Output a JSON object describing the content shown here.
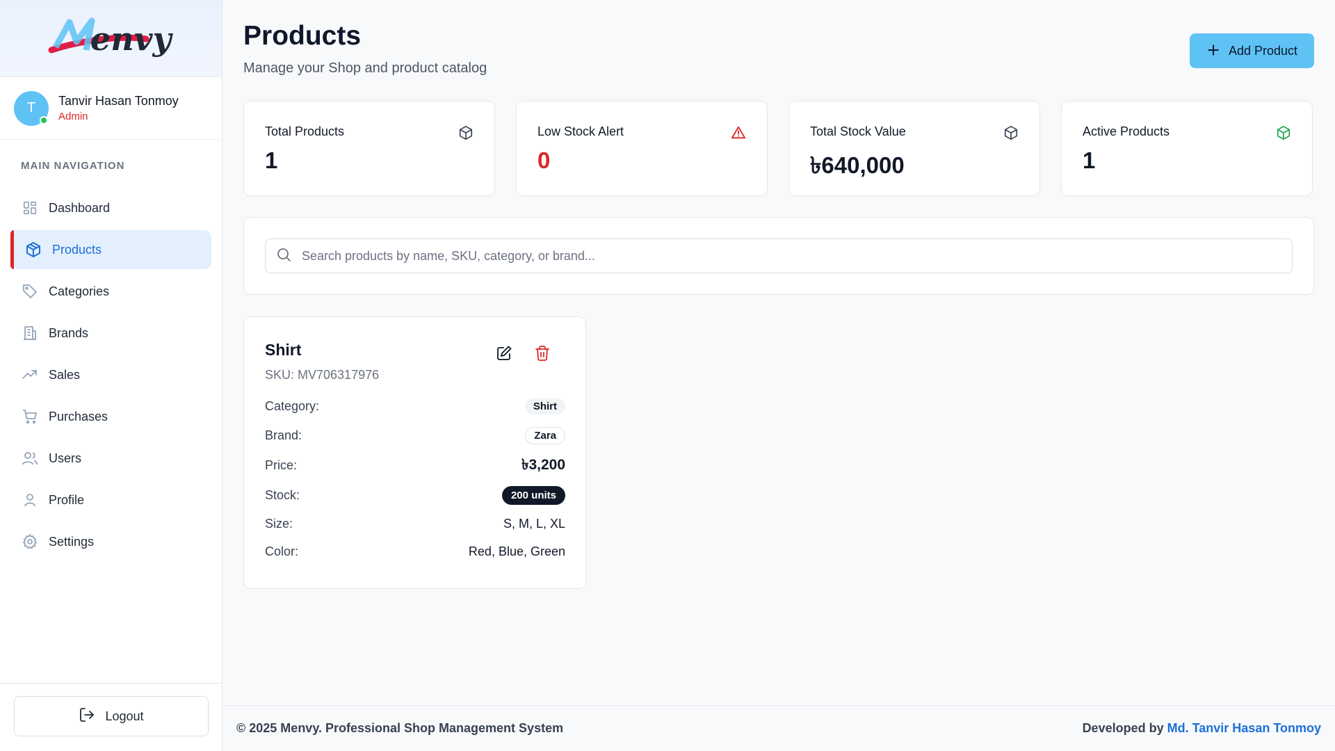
{
  "brand": {
    "logo_text": "Menvy",
    "logo_color": "#1f2937",
    "accent_pink": "#e11d48",
    "accent_blue": "#5ec2f5"
  },
  "user": {
    "initial": "T",
    "name": "Tanvir Hasan Tonmoy",
    "role": "Admin",
    "status": "online"
  },
  "sidebar": {
    "heading": "MAIN NAVIGATION",
    "items": [
      {
        "label": "Dashboard",
        "icon": "grid-icon",
        "active": false
      },
      {
        "label": "Products",
        "icon": "box-icon",
        "active": true
      },
      {
        "label": "Categories",
        "icon": "tag-icon",
        "active": false
      },
      {
        "label": "Brands",
        "icon": "building-icon",
        "active": false
      },
      {
        "label": "Sales",
        "icon": "trending-up-icon",
        "active": false
      },
      {
        "label": "Purchases",
        "icon": "cart-icon",
        "active": false
      },
      {
        "label": "Users",
        "icon": "users-icon",
        "active": false
      },
      {
        "label": "Profile",
        "icon": "user-icon",
        "active": false
      },
      {
        "label": "Settings",
        "icon": "gear-icon",
        "active": false
      }
    ],
    "logout_label": "Logout"
  },
  "header": {
    "title": "Products",
    "subtitle": "Manage your Shop and product catalog",
    "add_button_label": "Add Product"
  },
  "stats": [
    {
      "title": "Total Products",
      "value": "1",
      "icon": "box-icon",
      "value_color": "#111827"
    },
    {
      "title": "Low Stock Alert",
      "value": "0",
      "icon": "alert-triangle-icon",
      "value_color": "#dc2626"
    },
    {
      "title": "Total Stock Value",
      "value": "৳640,000",
      "icon": "box-icon",
      "value_color": "#111827"
    },
    {
      "title": "Active Products",
      "value": "1",
      "icon": "box-icon",
      "value_color": "#111827"
    }
  ],
  "search": {
    "placeholder": "Search products by name, SKU, category, or brand...",
    "value": ""
  },
  "products": [
    {
      "name": "Shirt",
      "sku": "SKU: MV706317976",
      "fields": {
        "category_label": "Category:",
        "category": "Shirt",
        "brand_label": "Brand:",
        "brand": "Zara",
        "price_label": "Price:",
        "price": "৳3,200",
        "stock_label": "Stock:",
        "stock": "200 units",
        "size_label": "Size:",
        "size": "S, M, L, XL",
        "color_label": "Color:",
        "color": "Red, Blue, Green"
      }
    }
  ],
  "footer": {
    "copyright": "© 2025 Menvy. Professional Shop Management System",
    "developed_by": "Developed by",
    "developer": "Md. Tanvir Hasan Tonmoy"
  }
}
